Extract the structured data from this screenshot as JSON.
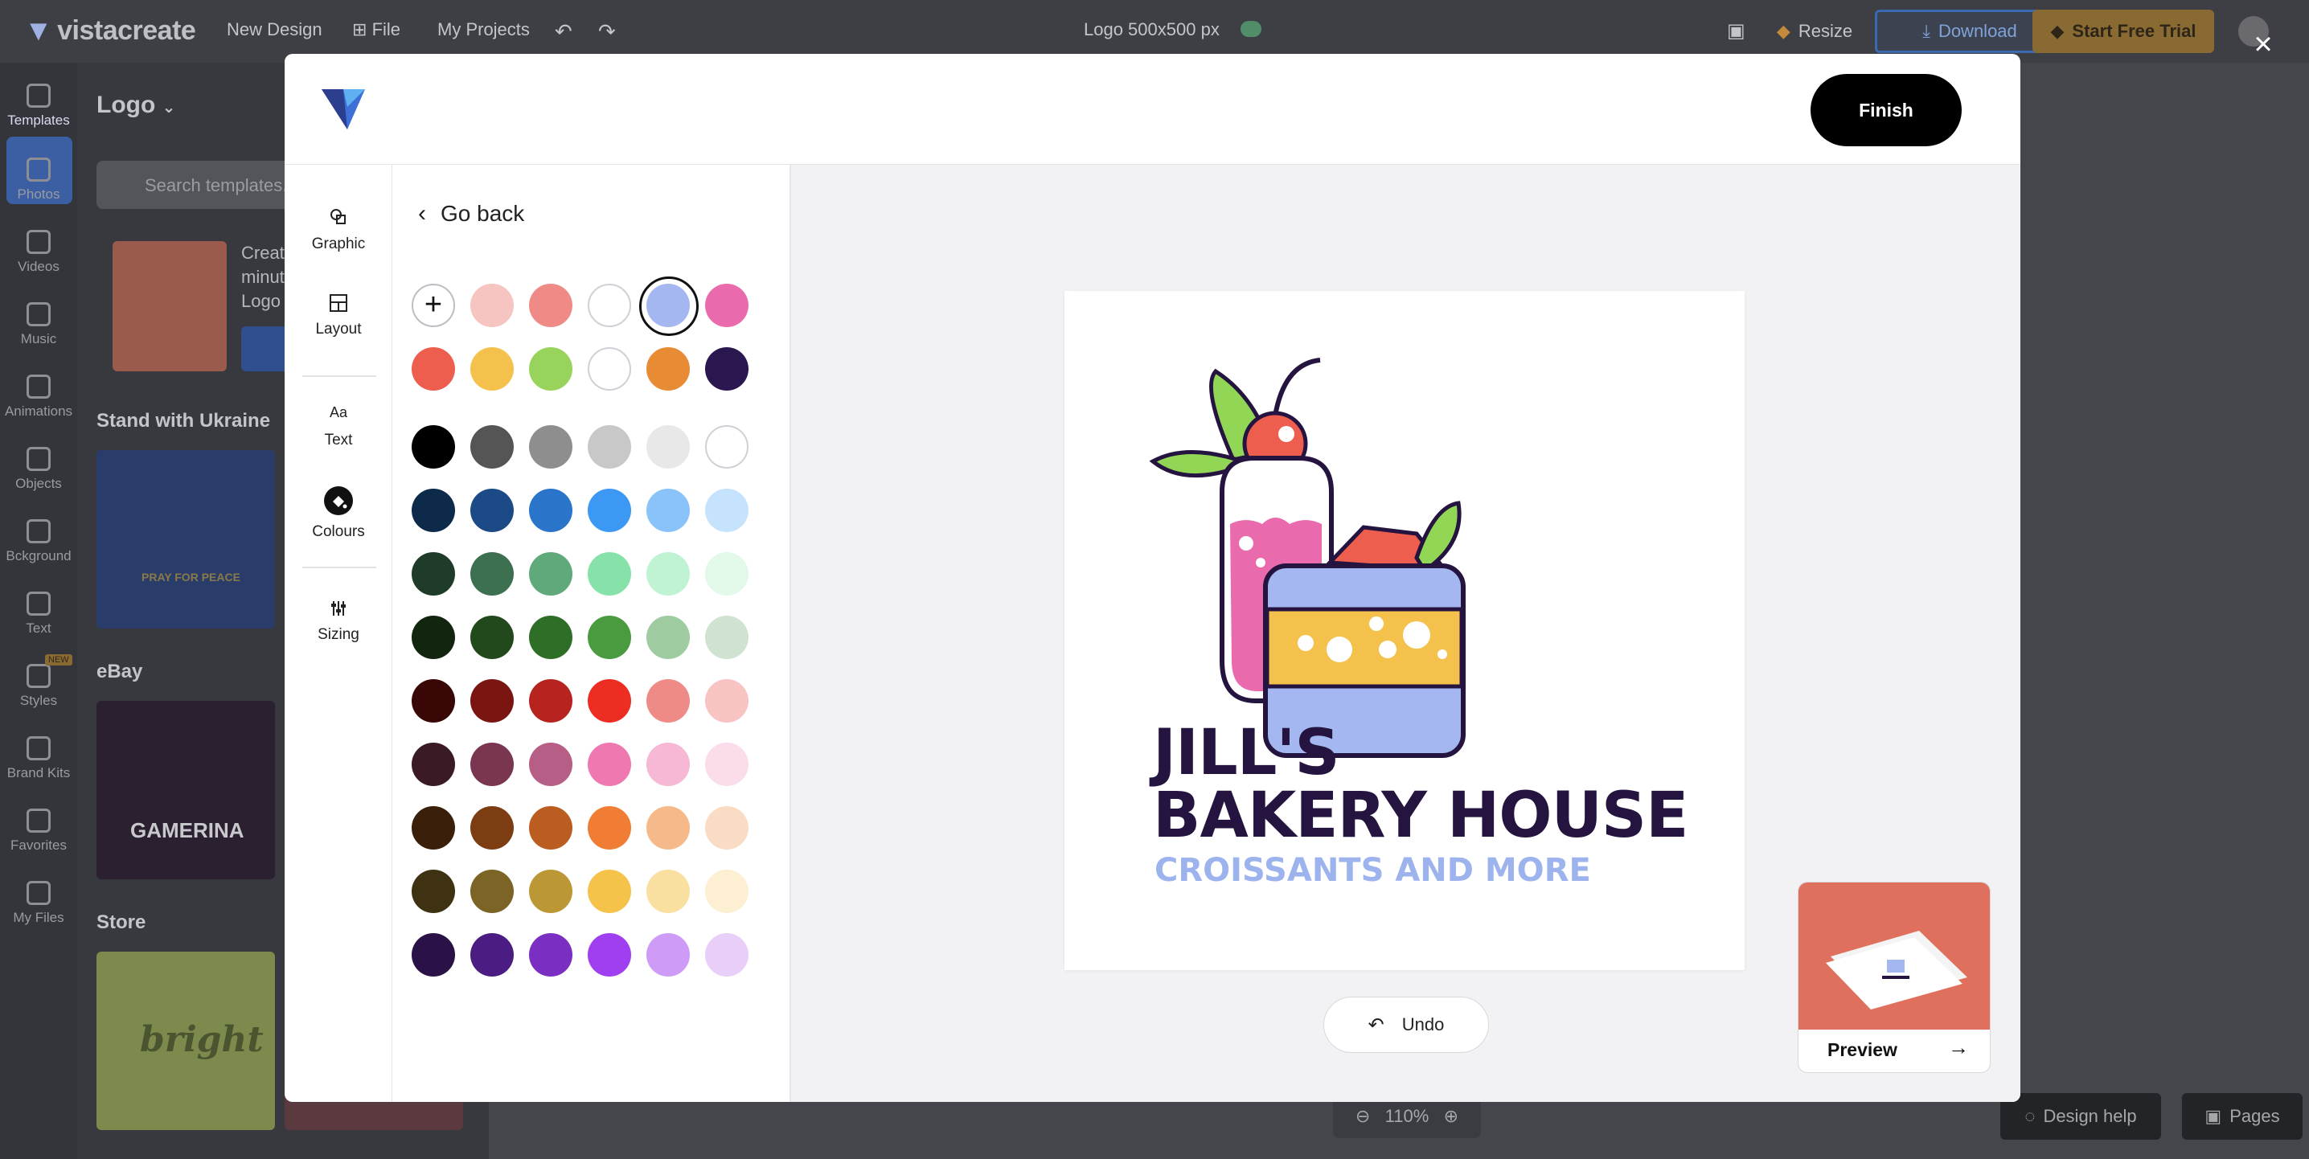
{
  "topbar": {
    "brand": "vistacreate",
    "menu": [
      "New Design",
      "File",
      "My Projects"
    ],
    "doc_title": "Logo 500x500 px",
    "resize_label": "Resize",
    "download_label": "Download",
    "trial_label": "Start Free Trial"
  },
  "rail": [
    {
      "label": "Templates",
      "icon": "templates-icon"
    },
    {
      "label": "Photos",
      "icon": "photos-icon"
    },
    {
      "label": "Videos",
      "icon": "videos-icon"
    },
    {
      "label": "Music",
      "icon": "music-icon"
    },
    {
      "label": "Animations",
      "icon": "animations-icon"
    },
    {
      "label": "Objects",
      "icon": "objects-icon"
    },
    {
      "label": "Bckground",
      "icon": "background-icon"
    },
    {
      "label": "Text",
      "icon": "text-icon"
    },
    {
      "label": "Styles",
      "icon": "styles-icon",
      "badge": "NEW"
    },
    {
      "label": "Brand Kits",
      "icon": "brand-kits-icon"
    },
    {
      "label": "Favorites",
      "icon": "favorites-icon"
    },
    {
      "label": "My Files",
      "icon": "my-files-icon"
    }
  ],
  "sidepanel": {
    "title": "Logo",
    "search_placeholder": "Search templates...",
    "promo_text": "Creat\nminut\nLogo",
    "sections": [
      "Stand with Ukraine",
      "eBay",
      "Store"
    ],
    "thumb_texts": [
      "PRAY FOR PEACE",
      "GAMERINA",
      "bright"
    ]
  },
  "bottom": {
    "zoom": "110%",
    "design_help": "Design help",
    "pages": "Pages"
  },
  "modal": {
    "finish_label": "Finish",
    "tools": [
      {
        "label": "Graphic",
        "icon": "graphic-icon"
      },
      {
        "label": "Layout",
        "icon": "layout-icon"
      },
      {
        "label": "Text",
        "icon": "text-aa-icon",
        "glyph": "Aa"
      },
      {
        "label": "Colours",
        "icon": "palette-icon",
        "active": true
      },
      {
        "label": "Sizing",
        "icon": "sliders-icon"
      }
    ],
    "go_back": "Go back",
    "palette_rows": [
      [
        "#f6c4c1",
        "#ef8a86",
        "#ffffff",
        "#a4b7f0",
        "#e96bad"
      ],
      [
        "#ee5e4f",
        "#f5c14d",
        "#98d45b",
        "#ffffff",
        "#e88b35",
        "#2b1750"
      ]
    ],
    "selected_swatch": "#a4b7f0",
    "swatch_grid": [
      [
        "#000000",
        "#555555",
        "#8e8e8e",
        "#c8c8c8",
        "#e8e8e8",
        "#ffffff"
      ],
      [
        "#0d2a4a",
        "#1b4a87",
        "#2a74c9",
        "#3d98f4",
        "#8ac3f9",
        "#c5e3fc"
      ],
      [
        "#1f3c2b",
        "#3d7050",
        "#5fa97a",
        "#86e2a9",
        "#bff3d4",
        "#e2f9ea"
      ],
      [
        "#12250f",
        "#22491b",
        "#2f6e27",
        "#4a9a40",
        "#9fcba1",
        "#cfe3d0"
      ],
      [
        "#3a0707",
        "#7b1512",
        "#b7231f",
        "#ee2d22",
        "#ef8b87",
        "#f7c4c2"
      ],
      [
        "#3a1a25",
        "#7a3550",
        "#b65e86",
        "#ef78b0",
        "#f6b8d5",
        "#fbdcea"
      ],
      [
        "#3a1f0a",
        "#7c3d13",
        "#bb5c21",
        "#f07d33",
        "#f6b98a",
        "#fadcc4"
      ],
      [
        "#3e3212",
        "#7c6426",
        "#bc9736",
        "#f6c34a",
        "#f9e0a1",
        "#fdf0d2"
      ],
      [
        "#2a1147",
        "#4b1c82",
        "#7a2fc2",
        "#a03ff0",
        "#ce9bf7",
        "#e7cff9"
      ]
    ],
    "artboard": {
      "line1": "JILL'S",
      "line2": "BAKERY HOUSE",
      "line3": "CROISSANTS AND MORE",
      "title_color": "#24143f",
      "subtitle_color": "#9db3ee"
    },
    "undo_label": "Undo",
    "preview_label": "Preview"
  }
}
